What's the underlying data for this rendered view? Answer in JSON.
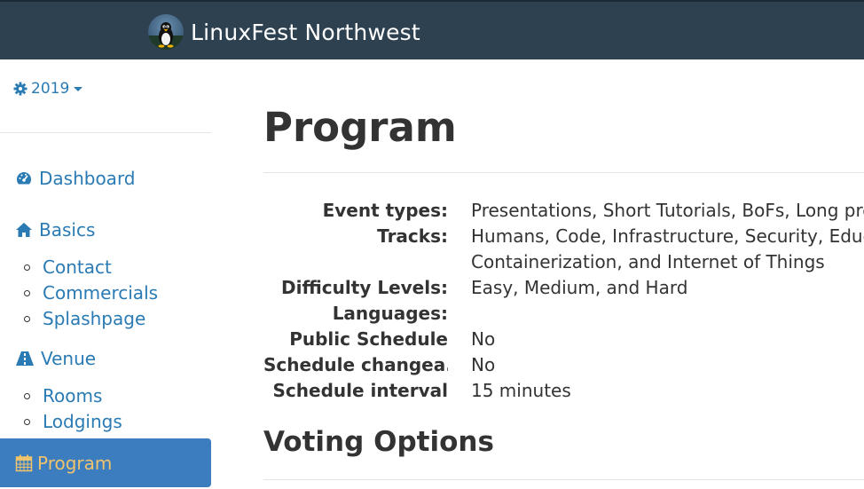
{
  "header": {
    "brand_name": "LinuxFest Northwest",
    "bg_color": "#2e4150",
    "logo_icon": "tux-penguin-icon"
  },
  "sidebar": {
    "year_selector": {
      "label": "2019",
      "icon": "gear-icon"
    },
    "nav": [
      {
        "label": "Dashboard",
        "icon": "dashboard-icon"
      },
      {
        "label": "Basics",
        "icon": "home-icon",
        "children": [
          "Contact",
          "Commercials",
          "Splashpage"
        ]
      },
      {
        "label": "Venue",
        "icon": "road-icon",
        "children": [
          "Rooms",
          "Lodgings"
        ]
      },
      {
        "label": "Program",
        "icon": "calendar-icon",
        "active": true
      }
    ],
    "link_color": "#2a7ab4",
    "active_bg": "#3c7dbf",
    "active_text_color": "#f0c36d"
  },
  "main": {
    "title": "Program",
    "properties": [
      {
        "label": "Event types:",
        "value": "Presentations, Short Tutorials, BoFs, Long presentations"
      },
      {
        "label": "Tracks:",
        "value": "Humans, Code, Infrastructure, Security, Education,",
        "value_line2": "Containerization, and Internet of Things"
      },
      {
        "label": "Difficulty Levels:",
        "value": "Easy, Medium, and Hard"
      },
      {
        "label": "Languages:",
        "value": ""
      },
      {
        "label": "Public Schedule",
        "value": "No"
      },
      {
        "label": "Schedule changea...",
        "value": "No"
      },
      {
        "label": "Schedule interval",
        "value": "15 minutes"
      }
    ],
    "section_title": "Voting Options"
  }
}
